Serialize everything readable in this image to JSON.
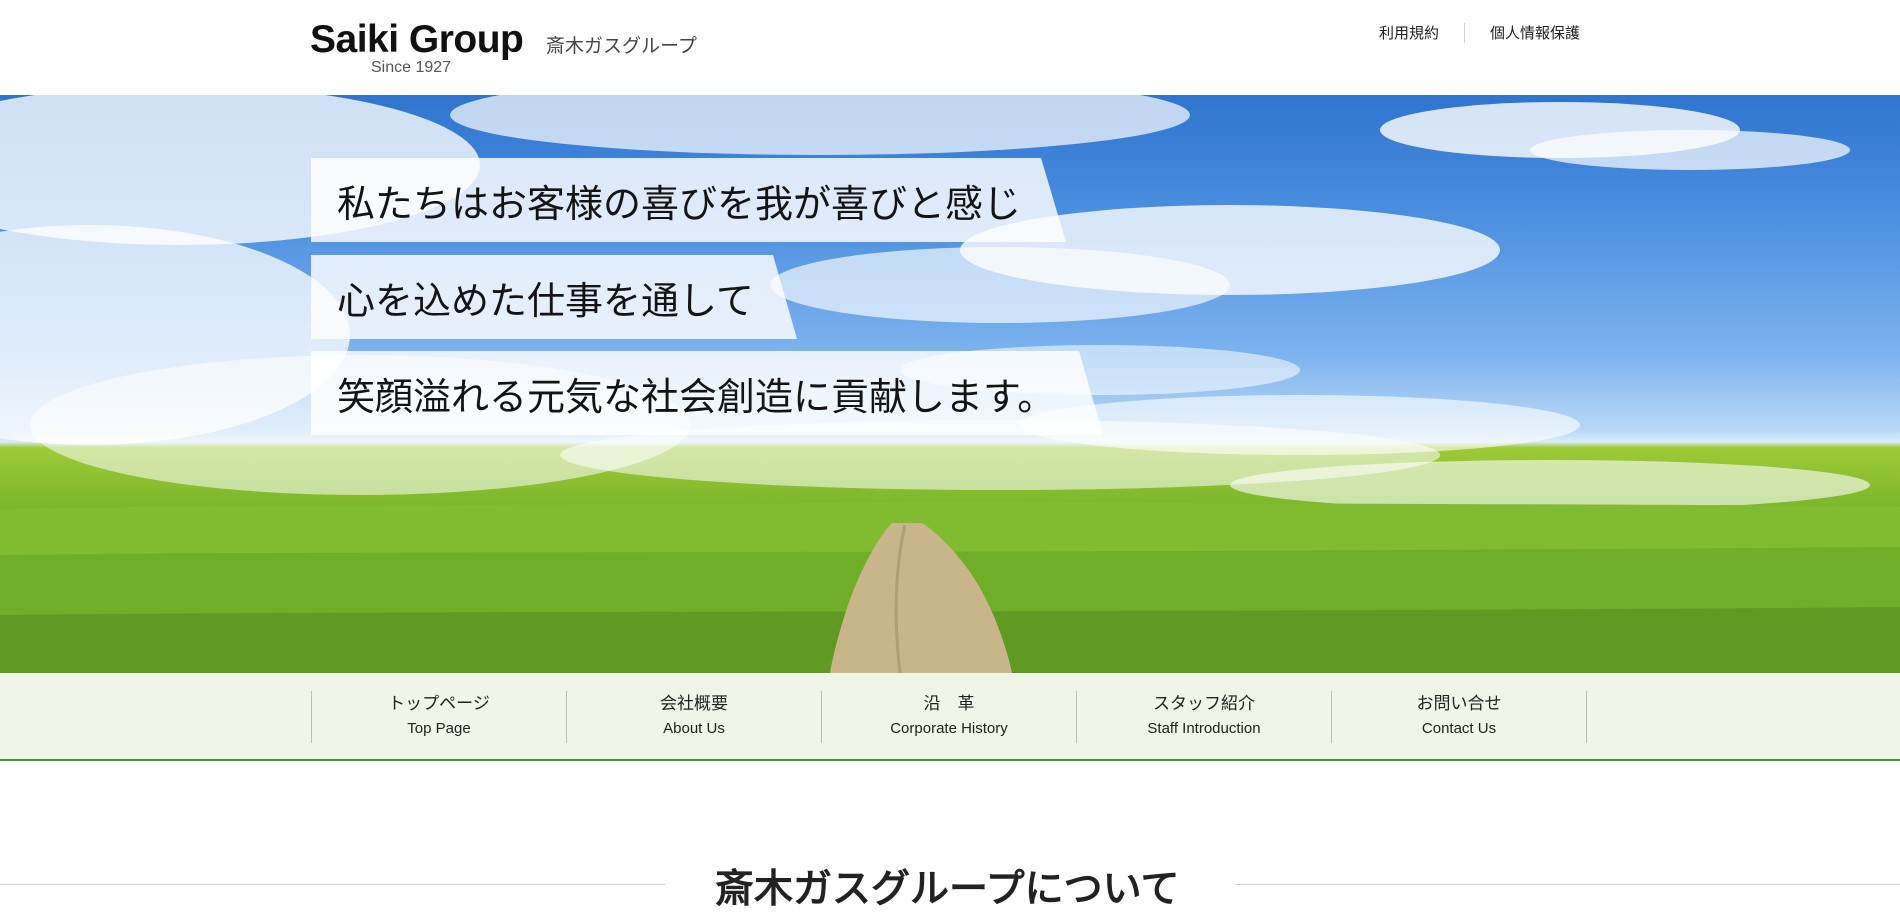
{
  "header": {
    "logo_main": "Saiki Group",
    "logo_since": "Since 1927",
    "logo_sub": "斎木ガスグループ",
    "links": [
      "利用規約",
      "個人情報保護"
    ]
  },
  "hero": {
    "slogans": [
      "私たちはお客様の喜びを我が喜びと感じ",
      "心を込めた仕事を通して",
      "笑顔溢れる元気な社会創造に貢献します。"
    ]
  },
  "nav": {
    "items": [
      {
        "jp": "トップページ",
        "en": "Top Page"
      },
      {
        "jp": "会社概要",
        "en": "About Us"
      },
      {
        "jp": "沿　革",
        "en": "Corporate History"
      },
      {
        "jp": "スタッフ紹介",
        "en": "Staff Introduction"
      },
      {
        "jp": "お問い合せ",
        "en": "Contact Us"
      }
    ]
  },
  "section": {
    "title": "斎木ガスグループについて"
  },
  "colors": {
    "nav_bg": "#f0f5e7",
    "nav_border": "#3a9a3a",
    "sky": "#4a8ee0",
    "grass": "#79b52a"
  }
}
